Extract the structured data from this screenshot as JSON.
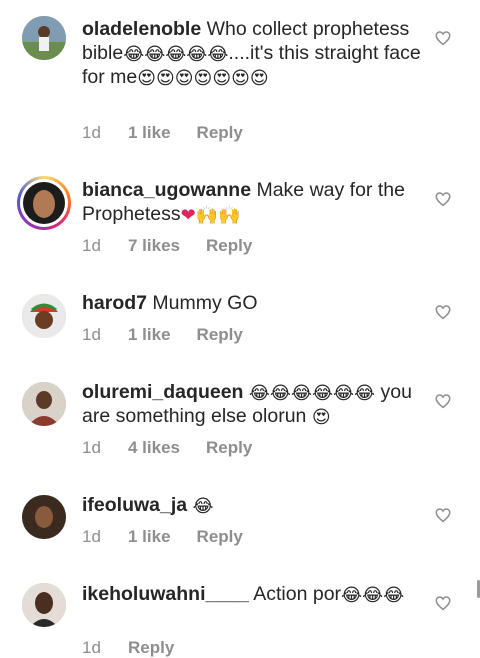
{
  "comments": [
    {
      "username": "oladelenoble",
      "text_before": " Who collect prophetess bible",
      "emoji1": "😂😂😂😂😂",
      "text_after": "....it's this straight face for me",
      "emoji2": "😍😍😍😍😍😍😍",
      "time": "1d",
      "likes": "1 like",
      "reply": "Reply",
      "has_story": false
    },
    {
      "username": "bianca_ugowanne",
      "text_before": " Make way for the Prophetess",
      "emoji1": "❤🙌🙌",
      "text_after": "",
      "emoji2": "",
      "time": "1d",
      "likes": "7 likes",
      "reply": "Reply",
      "has_story": true
    },
    {
      "username": "harod7",
      "text_before": " Mummy GO",
      "emoji1": "",
      "text_after": "",
      "emoji2": "",
      "time": "1d",
      "likes": "1 like",
      "reply": "Reply",
      "has_story": false
    },
    {
      "username": "oluremi_daqueen",
      "text_before": " ",
      "emoji1": "😂😂😂😂😂😂",
      "text_after": " you are something else olorun ",
      "emoji2": "😍",
      "time": "1d",
      "likes": "4 likes",
      "reply": "Reply",
      "has_story": false
    },
    {
      "username": "ifeoluwa_ja",
      "text_before": " ",
      "emoji1": "😂",
      "text_after": "",
      "emoji2": "",
      "time": "1d",
      "likes": "1 like",
      "reply": "Reply",
      "has_story": false
    },
    {
      "username": "ikeholuwahni____",
      "text_before": " Action por",
      "emoji1": "😂😂😂",
      "text_after": "",
      "emoji2": "",
      "time": "1d",
      "likes": "",
      "reply": "Reply",
      "has_story": false
    }
  ],
  "icons": {
    "like": "heart-outline-icon"
  },
  "colors": {
    "text": "#262626",
    "meta": "#8e8e8e",
    "story_ring": [
      "#feda75",
      "#fa7e1e",
      "#d62976",
      "#962fbf"
    ]
  }
}
